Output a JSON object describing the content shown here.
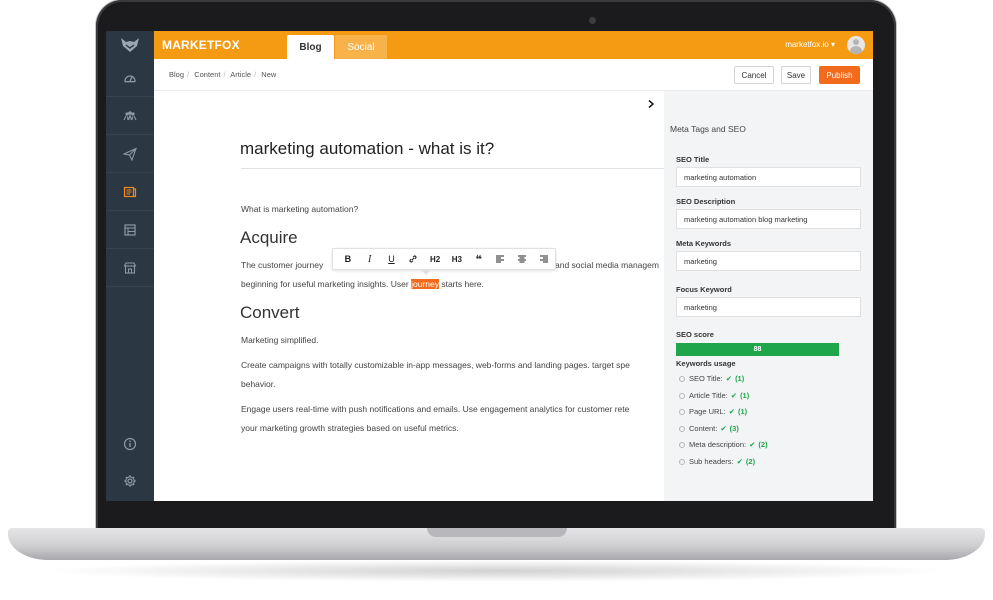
{
  "app": {
    "brand": "MARKETFOX",
    "account": "marketfox.io ▾"
  },
  "tabs": [
    {
      "label": "Blog"
    },
    {
      "label": "Social"
    }
  ],
  "breadcrumb": [
    "Blog",
    "Content",
    "Article",
    "New"
  ],
  "actions": {
    "cancel": "Cancel",
    "save": "Save",
    "publish": "Publish"
  },
  "sidebar": {
    "items": [
      {
        "icon": "dashboard-icon"
      },
      {
        "icon": "users-icon"
      },
      {
        "icon": "paper-plane-icon"
      },
      {
        "icon": "content-icon",
        "active": true
      },
      {
        "icon": "layout-icon"
      },
      {
        "icon": "shop-icon"
      },
      {
        "icon": "info-icon"
      },
      {
        "icon": "gear-icon"
      }
    ]
  },
  "article": {
    "title": "marketing automation - what is it?",
    "intro": "What is marketing automation?",
    "h_acquire": "Acquire",
    "acquire_p1_start": "The customer journey",
    "acquire_p1_end": "and social media managem",
    "acquire_p2_before": "beginning for useful marketing insights. User ",
    "acquire_p2_highlight": "journey",
    "acquire_p2_after": " starts here.",
    "h_convert": "Convert",
    "convert_p1": "Marketing simplified.",
    "convert_p2": "Create campaigns with totally customizable in-app messages, web-forms and landing pages. target spe",
    "convert_p3": "behavior.",
    "convert_p4": "Engage users real-time with push notifications and emails. Use engagement analytics for customer rete",
    "convert_p5": "your marketing growth strategies based on useful metrics."
  },
  "format_toolbar": {
    "bold": "B",
    "italic": "I",
    "underline": "U",
    "link": "link-icon",
    "h2": "H2",
    "h3": "H3",
    "quote": "❝",
    "align_left": "align-left-icon",
    "align_center": "align-center-icon",
    "align_right": "align-right-icon"
  },
  "seo": {
    "panel_title": "Meta Tags and SEO",
    "seo_title_label": "SEO Title",
    "seo_title_value": "marketing automation",
    "seo_desc_label": "SEO Description",
    "seo_desc_value": "marketing automation blog marketing",
    "meta_keywords_label": "Meta Keywords",
    "meta_keywords_value": "marketing",
    "focus_keyword_label": "Focus Keyword",
    "focus_keyword_value": "marketing",
    "score_label": "SEO score",
    "score_value": "88",
    "keywords_usage_label": "Keywords usage",
    "usage": [
      {
        "label": "SEO Title:",
        "count": "(1)"
      },
      {
        "label": "Article Title:",
        "count": "(1)"
      },
      {
        "label": "Page URL:",
        "count": "(1)"
      },
      {
        "label": "Content:",
        "count": "(3)"
      },
      {
        "label": "Meta description:",
        "count": "(2)"
      },
      {
        "label": "Sub headers:",
        "count": "(2)"
      }
    ]
  },
  "colors": {
    "accent": "#f49a13",
    "publish": "#f26a1b",
    "sidebar": "#2c3744",
    "score": "#1fa64a"
  }
}
